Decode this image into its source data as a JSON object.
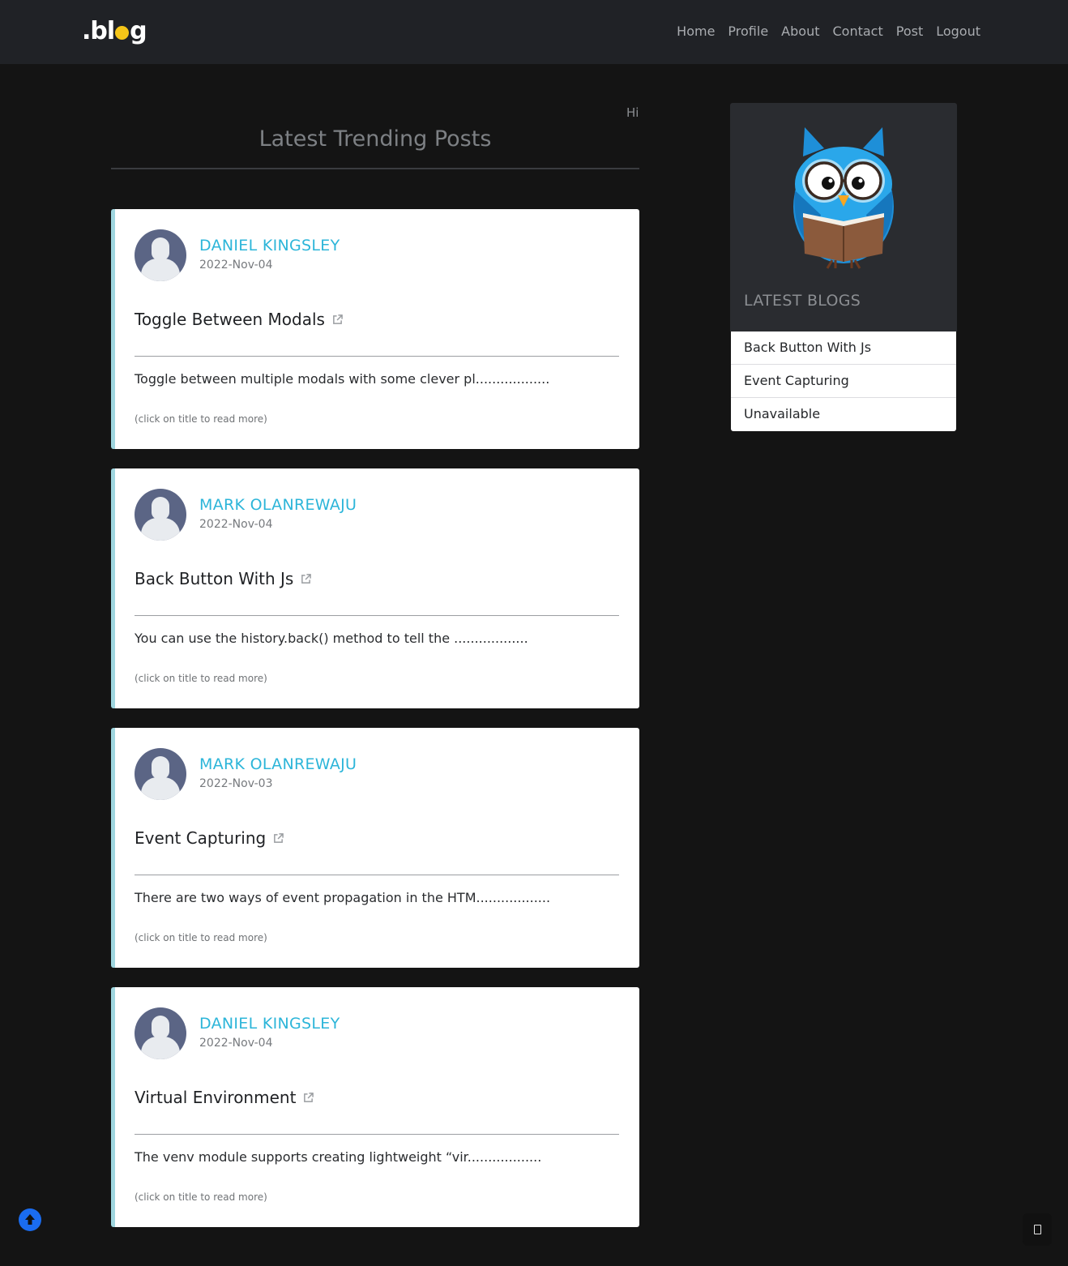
{
  "navbar": {
    "logo_prefix": ".bl",
    "logo_suffix": "g",
    "links": [
      {
        "label": "Home"
      },
      {
        "label": "Profile"
      },
      {
        "label": "About"
      },
      {
        "label": "Contact"
      },
      {
        "label": "Post"
      },
      {
        "label": "Logout"
      }
    ]
  },
  "main": {
    "greeting": "Hi",
    "heading": "Latest Trending Posts",
    "posts": [
      {
        "author": "DANIEL KINGSLEY",
        "date": "2022-Nov-04",
        "title": "Toggle Between Modals",
        "excerpt": "Toggle between multiple modals with some clever pl..................",
        "hint": "(click on title to read more)"
      },
      {
        "author": "MARK OLANREWAJU",
        "date": "2022-Nov-04",
        "title": "Back Button With Js",
        "excerpt": "You can use the history.back() method to tell the ..................",
        "hint": "(click on title to read more)"
      },
      {
        "author": "MARK OLANREWAJU",
        "date": "2022-Nov-03",
        "title": "Event Capturing",
        "excerpt": "There are two ways of event propagation in the HTM..................",
        "hint": "(click on title to read more)"
      },
      {
        "author": "DANIEL KINGSLEY",
        "date": "2022-Nov-04",
        "title": "Virtual Environment",
        "excerpt": "The venv module supports creating lightweight “vir..................",
        "hint": "(click on title to read more)"
      }
    ]
  },
  "sidebar": {
    "heading": "LATEST BLOGS",
    "items": [
      {
        "label": "Back Button With Js"
      },
      {
        "label": "Event Capturing"
      },
      {
        "label": "Unavailable"
      }
    ]
  },
  "colors": {
    "background": "#141414",
    "navbar": "#202226",
    "author_accent": "#2cb5d9",
    "card_border": "#9fd6df",
    "scroll_button": "#1a6cf0",
    "logo_dot": "#f5c518"
  },
  "icons": {
    "scroll_top": "arrow-up-circle-icon",
    "external_link": "external-link-icon",
    "avatar": "user-avatar-icon",
    "mascot": "owl-reading-book-icon"
  }
}
